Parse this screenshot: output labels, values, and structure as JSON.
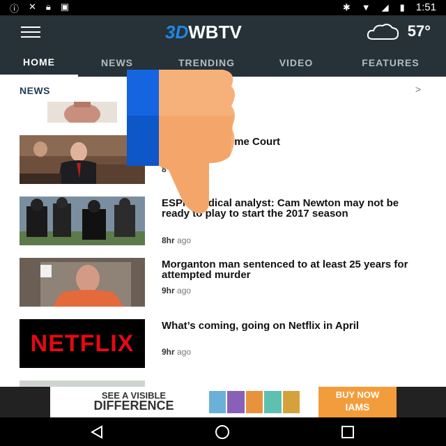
{
  "status_bar": {
    "time": "1:51",
    "left_icons": [
      "info-icon",
      "no-sim-icon",
      "lock-icon",
      "robot-icon"
    ],
    "right_icons": [
      "bluetooth-icon",
      "wifi-icon",
      "no-signal-icon",
      "battery-charging-icon"
    ]
  },
  "app_bar": {
    "logo_badge": "3D",
    "logo_text": "WBTV",
    "weather_icon": "partly-cloudy-icon",
    "temperature": "57°"
  },
  "tabs": [
    {
      "label": "HOME",
      "active": true
    },
    {
      "label": "NEWS",
      "active": false
    },
    {
      "label": "TRENDING",
      "active": false
    },
    {
      "label": "VIDEO",
      "active": false
    },
    {
      "label": "FEATURES",
      "active": false
    }
  ],
  "section": {
    "title": "NEWS",
    "chevron": ">"
  },
  "articles": [
    {
      "headline": "rejected Supreme Court\n0 years ago",
      "time_num": "8",
      "time_unit": "ago",
      "thumb": "hearing-photo"
    },
    {
      "headline": "ESPN medical analyst: Cam Newton may not be ready to play to start the 2017 season",
      "time_num": "8hr",
      "time_unit": "ago",
      "thumb": "football-photo"
    },
    {
      "headline": "Morganton man sentenced to at least 25 years for attempted murder",
      "time_num": "9hr",
      "time_unit": "ago",
      "thumb": "mugshot-photo"
    },
    {
      "headline": "What’s coming, going on Netflix in April",
      "time_num": "9hr",
      "time_unit": "ago",
      "thumb": "netflix-logo",
      "thumb_text": "NETFLIX"
    }
  ],
  "ad": {
    "line1": "SEE A VISIBLE",
    "line2": "DIFFERENCE",
    "cta": "BUY NOW",
    "brand": "IAMS"
  },
  "nav": [
    "back-icon",
    "home-icon",
    "recents-icon"
  ],
  "overlay_icon": "thumbs-down-icon",
  "colors": {
    "app_bar": "#263238",
    "tab_active": "#ffffff",
    "tab_inactive": "#b0bec5",
    "section_title": "#243c5a",
    "logo_accent": "#1e88e5",
    "overlay_blue": "#1565e0",
    "overlay_skin": "#f6b17a",
    "ad_cta": "#f39c3c"
  }
}
